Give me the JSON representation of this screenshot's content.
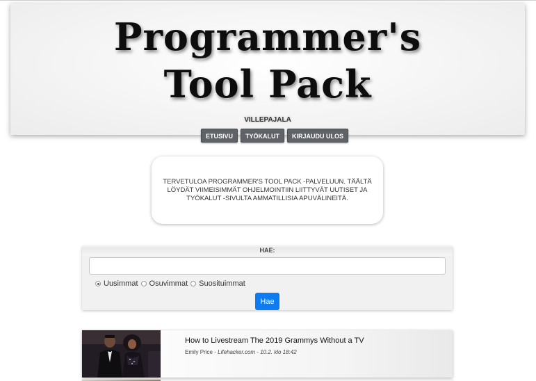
{
  "header": {
    "title_line1": "Programmer's",
    "title_line2": "Tool Pack",
    "owner": "VILLEPAJALA"
  },
  "nav": {
    "items": [
      {
        "label": "ETUSIVU"
      },
      {
        "label": "TYÖKALUT"
      },
      {
        "label": "KIRJAUDU ULOS"
      }
    ]
  },
  "welcome": {
    "text": "TERVETULOA PROGRAMMER'S TOOL PACK -PALVELUUN. TÄÄLTÄ LÖYDÄT VIIMEISIMMÄT OHJELMOINTIIN LIITTYVÄT UUTISET JA TYÖKALUT -SIVULTA AMMATILLISIA APUVÄLINEITÄ."
  },
  "search": {
    "label": "HAE:",
    "input_value": "",
    "input_placeholder": "",
    "sort_options": [
      {
        "label": "Uusimmat",
        "checked": true
      },
      {
        "label": "Osuvimmat",
        "checked": false
      },
      {
        "label": "Suosituimmat",
        "checked": false
      }
    ],
    "button_label": "Hae",
    "button_color": "#0d7cf2"
  },
  "news": [
    {
      "title": "How to Livestream The 2019 Grammys Without a TV",
      "author": "Emily Price",
      "separator": " - ",
      "source": "Lifehacker.com",
      "date": " - 10.2. klo 18:42"
    }
  ]
}
